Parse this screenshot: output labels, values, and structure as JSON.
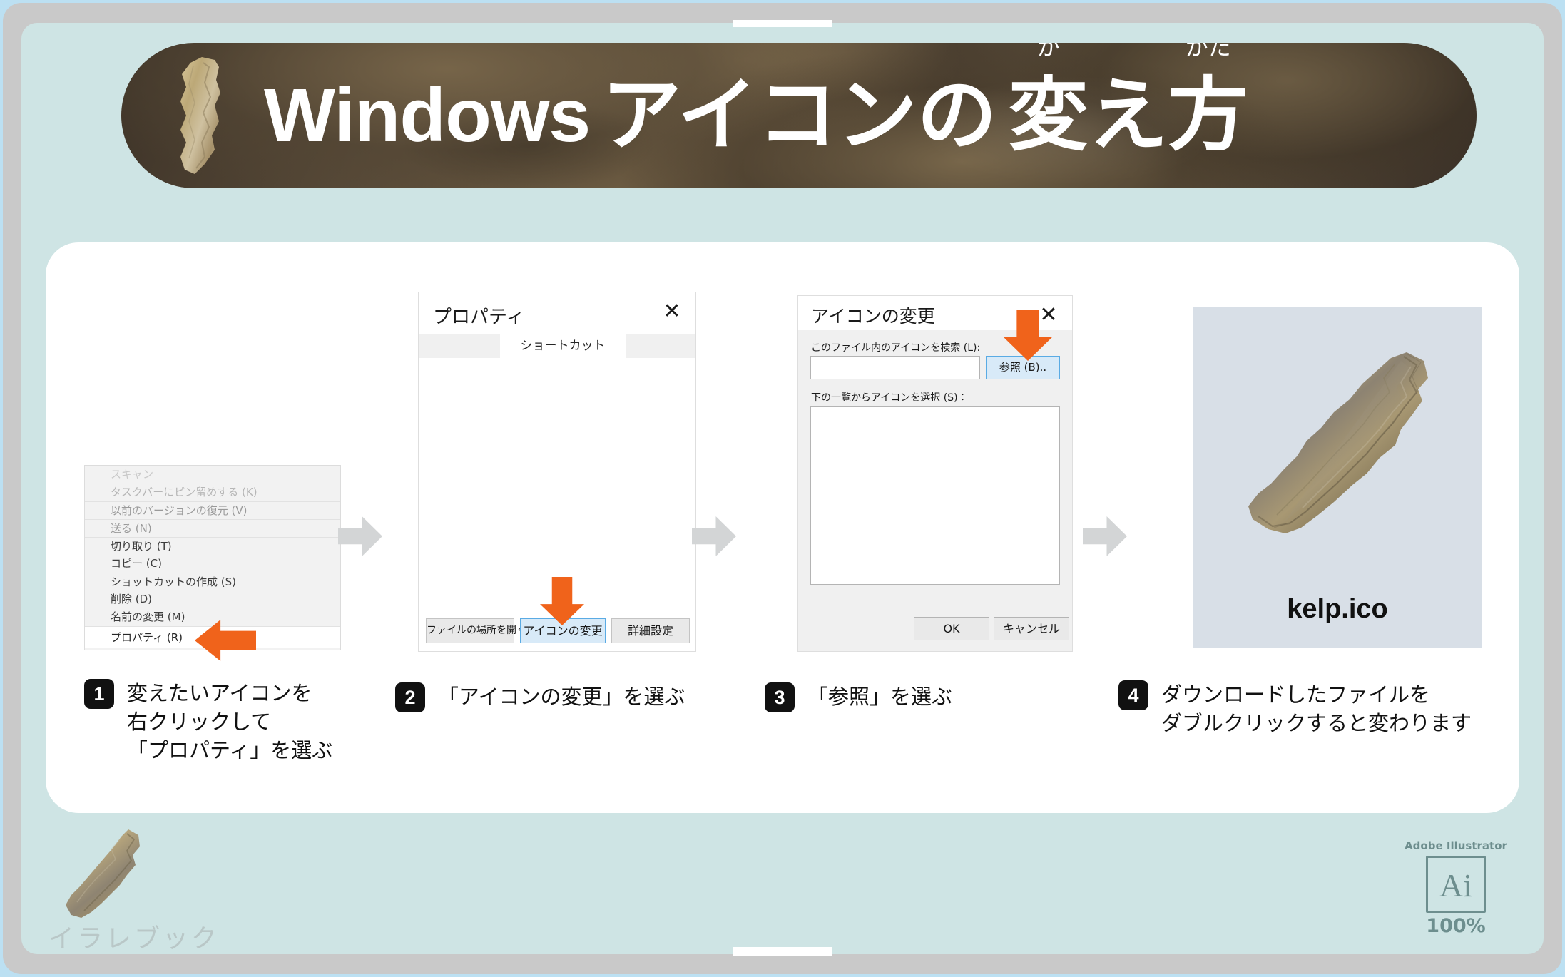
{
  "banner": {
    "title_en": "Windows",
    "title_jp_pre": "アイコンの",
    "title_kae": "変",
    "title_kae_ruby": "か",
    "title_e": "え",
    "title_kata": "方",
    "title_kata_ruby": "かた",
    "full_title": "Windows アイコンの変え方"
  },
  "step1": {
    "context_menu": [
      {
        "label": "スキャン",
        "state": "faded-1"
      },
      {
        "label": "タスクバーにピン留めする (K)",
        "state": "faded-2"
      },
      {
        "label": "以前のバージョンの復元 (V)",
        "state": "faded-3"
      },
      {
        "label": "送る (N)",
        "state": "faded-3"
      },
      {
        "label": "切り取り (T)",
        "state": "normal"
      },
      {
        "label": "コピー (C)",
        "state": "normal"
      },
      {
        "label": "ショットカットの作成 (S)",
        "state": "normal"
      },
      {
        "label": "削除 (D)",
        "state": "normal"
      },
      {
        "label": "名前の変更 (M)",
        "state": "normal"
      },
      {
        "label": "プロパティ (R)",
        "state": "highlight"
      }
    ]
  },
  "step2": {
    "dialog_title": "プロパティ",
    "close_label": "✕",
    "tab_label": "ショートカット",
    "buttons": {
      "open_location": "ファイルの場所を開く",
      "change_icon": "アイコンの変更",
      "advanced": "詳細設定"
    }
  },
  "step3": {
    "dialog_title": "アイコンの変更",
    "close_label": "✕",
    "search_label": "このファイル内のアイコンを検索 (L):",
    "search_value": "",
    "search_placeholder": "",
    "browse_button": "参照 (B)..",
    "select_label": "下の一覧からアイコンを選択 (S)：",
    "ok_button": "OK",
    "cancel_button": "キャンセル"
  },
  "step4": {
    "filename": "kelp.ico"
  },
  "captions": [
    {
      "number": "1",
      "text": "変えたいアイコンを\n右クリックして\n「プロパティ」を選ぶ"
    },
    {
      "number": "2",
      "text": "「アイコンの変更」を選ぶ"
    },
    {
      "number": "3",
      "text": "「参照」を選ぶ"
    },
    {
      "number": "4",
      "text": "ダウンロードしたファイルを\nダブルクリックすると変わります"
    }
  ],
  "footer": {
    "brand": "イラレブック",
    "badge_title": "Adobe Illustrator",
    "badge_glyph": "Ai",
    "badge_percent": "100%"
  },
  "colors": {
    "page_bg": "#cee4e4",
    "bezel": "#c9c9c9",
    "outer_frame": "#bce0f2",
    "card": "#ffffff",
    "accent_orange": "#f0631b",
    "step_arrow": "#d3d5d6",
    "result_panel": "#d8dfe7",
    "badge": "#6d8e8e",
    "watermark": "#b9c7c7",
    "highlight_blue": "#5aabe4"
  }
}
